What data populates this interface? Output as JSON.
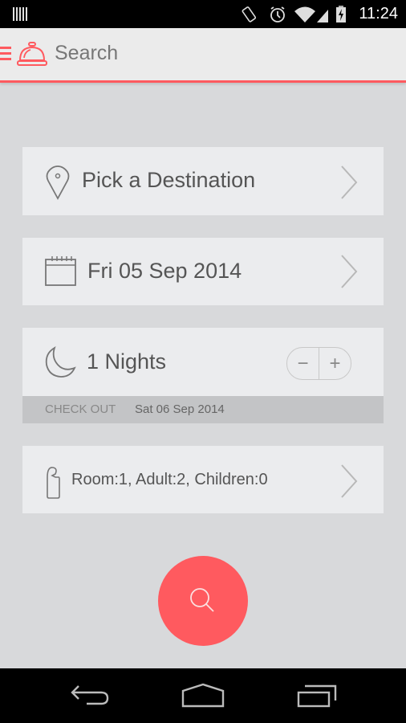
{
  "status_bar": {
    "time": "11:24",
    "icons": [
      "barcode-icon",
      "vibrate-icon",
      "alarm-icon",
      "wifi-icon",
      "signal-icon",
      "battery-charging-icon"
    ]
  },
  "app_bar": {
    "title": "Search",
    "menu_icon": "hamburger-menu-icon",
    "logo_icon": "service-bell-icon",
    "accent_color": "#ff5a5f"
  },
  "form": {
    "destination": {
      "label": "Pick a Destination",
      "icon": "location-pin-icon"
    },
    "checkin": {
      "label": "Fri 05 Sep 2014",
      "icon": "calendar-icon"
    },
    "nights": {
      "label": "1 Nights",
      "icon": "moon-icon",
      "decrement": "−",
      "increment": "+",
      "checkout_label": "CHECK OUT",
      "checkout_value": "Sat 06 Sep 2014"
    },
    "guests": {
      "label": "Room:1, Adult:2, Children:0",
      "icon": "door-hanger-icon"
    }
  },
  "search_button": {
    "icon": "search-icon",
    "color": "#ff5a5f"
  },
  "nav_bar": {
    "buttons": [
      "back-icon",
      "home-icon",
      "recent-apps-icon"
    ]
  }
}
